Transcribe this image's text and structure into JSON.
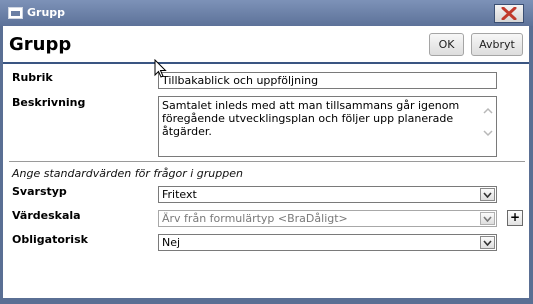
{
  "window": {
    "title": "Grupp",
    "colors": {
      "titlebar": "#6b80a7",
      "close_x": "#c0392b",
      "divider": "#3a5582"
    }
  },
  "header": {
    "title": "Grupp",
    "ok_label": "OK",
    "cancel_label": "Avbryt"
  },
  "form": {
    "rubrik": {
      "label": "Rubrik",
      "value": "Tillbakablick och uppföljning"
    },
    "beskrivning": {
      "label": "Beskrivning",
      "value": "Samtalet inleds med att man tillsammans går igenom föregående utvecklingsplan och följer upp planerade åtgärder."
    },
    "section_heading": "Ange standardvärden för frågor i gruppen",
    "svarstyp": {
      "label": "Svarstyp",
      "selected": "Fritext"
    },
    "vardeskala": {
      "label": "Värdeskala",
      "selected": "Ärv från formulärtyp <BraDåligt>",
      "add_label": "+"
    },
    "obligatorisk": {
      "label": "Obligatorisk",
      "selected": "Nej"
    }
  },
  "icons": {
    "app": "window-app-icon",
    "close": "close-x-icon",
    "dropdown": "chevron-down-icon",
    "cursor": "mouse-pointer-icon"
  }
}
